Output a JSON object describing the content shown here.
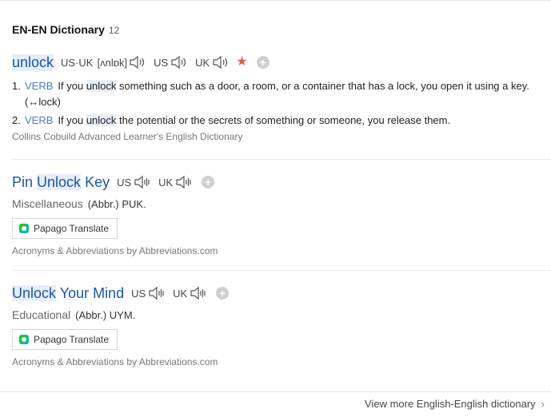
{
  "section": {
    "title": "EN-EN Dictionary",
    "count": "12"
  },
  "entry1": {
    "word": "unlock",
    "phonetic_label": "US·UK",
    "phonetic": "[ʌnlɒk]",
    "us_label": "US",
    "uk_label": "UK",
    "senses": [
      {
        "num": "1.",
        "pos": "VERB",
        "text_before": "If you",
        "highlight": "unlock",
        "text_after": "something such as a door, a room, or a container that has a lock, you open it using a key. (↔lock)"
      },
      {
        "num": "2.",
        "pos": "VERB",
        "text_before": "If you",
        "highlight": "unlock",
        "text_after": "the potential or the secrets of something or someone, you release them."
      }
    ],
    "source": "Collins Cobuild Advanced Learner's English Dictionary"
  },
  "entry2": {
    "word_pre": "Pin",
    "word_hl": "Unlock",
    "word_post": "Key",
    "us_label": "US",
    "uk_label": "UK",
    "category": "Miscellaneous",
    "abbr": "(Abbr.) PUK.",
    "translate_label": "Papago Translate",
    "source": "Acronyms & Abbreviations by Abbreviations.com"
  },
  "entry3": {
    "word_hl": "Unlock",
    "word_post": "Your Mind",
    "us_label": "US",
    "uk_label": "UK",
    "category": "Educational",
    "abbr": "(Abbr.) UYM.",
    "translate_label": "Papago Translate",
    "source": "Acronyms & Abbreviations by Abbreviations.com"
  },
  "footer": {
    "view_more": "View more English-English dictionary"
  },
  "icons": {
    "speaker": "speaker-icon",
    "star": "star-icon",
    "plus": "plus-icon",
    "papago": "papago-icon",
    "chevron": "chevron-right-icon"
  },
  "colors": {
    "link_blue": "#1a56a8",
    "pos_blue": "#4a7dc0",
    "star_red": "#e05a47",
    "highlight": "#e6eef8"
  }
}
